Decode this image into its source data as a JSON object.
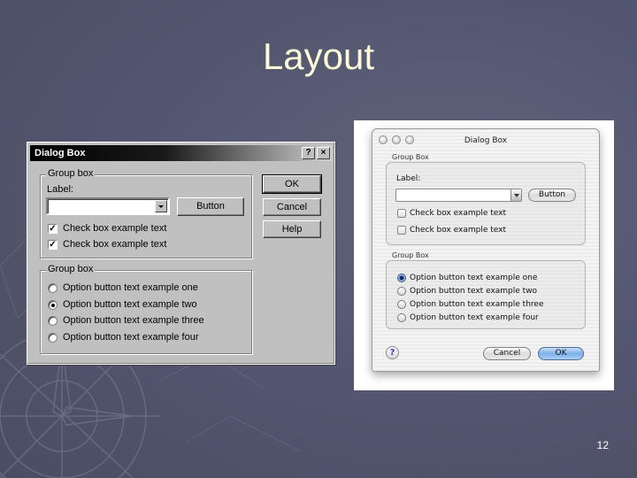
{
  "slide": {
    "title": "Layout",
    "page_number": "12"
  },
  "windows_dialog": {
    "title": "Dialog Box",
    "help_btn": "?",
    "close_btn": "×",
    "group1_label": "Group box",
    "field_label": "Label:",
    "combo_value": "",
    "button_label": "Button",
    "checkboxes": [
      {
        "label": "Check box example text",
        "checked": true
      },
      {
        "label": "Check box example text",
        "checked": true
      }
    ],
    "group2_label": "Group box",
    "radios": [
      {
        "label": "Option button text example one",
        "selected": false
      },
      {
        "label": "Option button text example two",
        "selected": true
      },
      {
        "label": "Option button text example three",
        "selected": false
      },
      {
        "label": "Option button text example four",
        "selected": false
      }
    ],
    "ok_label": "OK",
    "cancel_label": "Cancel",
    "help_label": "Help"
  },
  "mac_dialog": {
    "title": "Dialog Box",
    "group1_label": "Group Box",
    "field_label": "Label:",
    "combo_value": "",
    "button_label": "Button",
    "checkboxes": [
      {
        "label": "Check box example text",
        "checked": false
      },
      {
        "label": "Check box example text",
        "checked": false
      }
    ],
    "group2_label": "Group Box",
    "radios": [
      {
        "label": "Option button text example one",
        "selected": true
      },
      {
        "label": "Option button text example two",
        "selected": false
      },
      {
        "label": "Option button text example three",
        "selected": false
      },
      {
        "label": "Option button text example four",
        "selected": false
      }
    ],
    "help_glyph": "?",
    "cancel_label": "Cancel",
    "ok_label": "OK"
  },
  "colors": {
    "slide_background": "#555871",
    "title_text": "#fbfbd8",
    "win_face": "#c0c0c0",
    "mac_default_button": "#7fb0e8"
  }
}
